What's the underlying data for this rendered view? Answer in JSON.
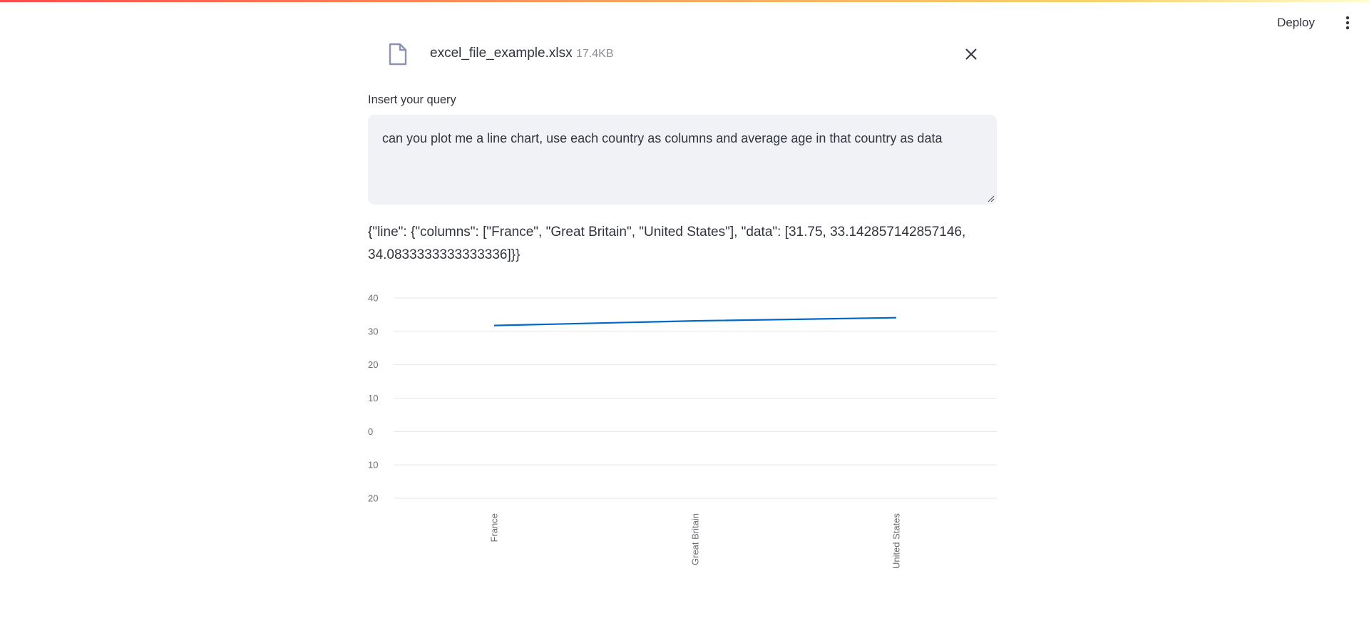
{
  "header": {
    "deploy_label": "Deploy",
    "menu_icon": "kebab-menu-icon"
  },
  "file": {
    "name": "excel_file_example.xlsx",
    "size": "17.4KB",
    "icon": "file-icon",
    "close_icon": "close-icon"
  },
  "query": {
    "label": "Insert your query",
    "value": "can you plot me a line chart, use each country as columns and average age in that country as data"
  },
  "result": {
    "text": "{\"line\": {\"columns\": [\"France\", \"Great Britain\", \"United States\"], \"data\": [31.75, 33.142857142857146, 34.0833333333333336]}}"
  },
  "colors": {
    "line": "#0068c9",
    "grid": "#e6e6e6",
    "text": "#31333f",
    "muted": "#8c8e96"
  },
  "chart_data": {
    "type": "line",
    "categories": [
      "France",
      "Great Britain",
      "United States"
    ],
    "values": [
      31.75,
      33.142857142857146,
      34.083333333333336
    ],
    "y_ticks": [
      {
        "value": 40,
        "label": "40"
      },
      {
        "value": 30,
        "label": "30"
      },
      {
        "value": 20,
        "label": "20"
      },
      {
        "value": 10,
        "label": "10"
      },
      {
        "value": 0,
        "label": "0"
      },
      {
        "value": -10,
        "label": "10"
      },
      {
        "value": -20,
        "label": "20"
      }
    ],
    "ylim": [
      -20,
      40
    ],
    "grid": true,
    "legend": "none"
  }
}
